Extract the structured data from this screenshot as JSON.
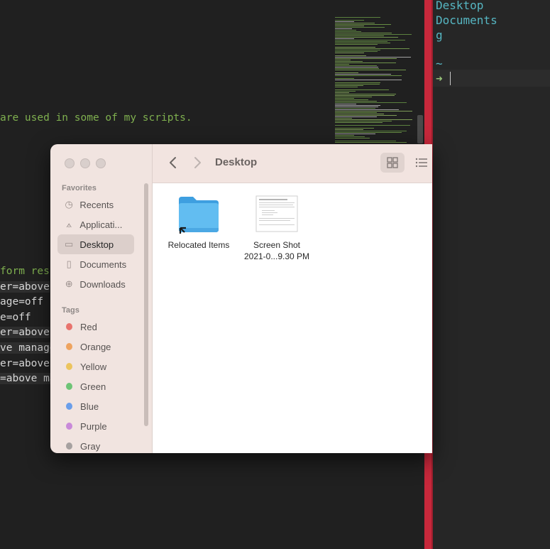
{
  "editor": {
    "lines": [
      {
        "text": "are used in some of my scripts.",
        "kind": "comment"
      },
      {
        "text": "form resi",
        "kind": "comment"
      },
      {
        "text": "er=above",
        "kind": "hl"
      },
      {
        "text": "age=off",
        "kind": "plain"
      },
      {
        "text": "e=off",
        "kind": "plain"
      },
      {
        "text": "er=above",
        "kind": "hl"
      },
      {
        "text": "ve manage",
        "kind": "hl"
      },
      {
        "text": "er=above",
        "kind": "plain"
      },
      {
        "text": "=above ma",
        "kind": "hl"
      }
    ]
  },
  "terminal": {
    "lines": [
      "Desktop",
      "Documents",
      "g"
    ],
    "tilde": "~",
    "prompt_symbol": "➜"
  },
  "finder": {
    "title": "Desktop",
    "favorites_header": "Favorites",
    "favorites": [
      {
        "label": "Recents",
        "icon": "clock-icon"
      },
      {
        "label": "Applicati...",
        "icon": "applications-icon"
      },
      {
        "label": "Desktop",
        "icon": "desktop-icon",
        "active": true
      },
      {
        "label": "Documents",
        "icon": "document-icon"
      },
      {
        "label": "Downloads",
        "icon": "download-icon"
      }
    ],
    "tags_header": "Tags",
    "tags": [
      {
        "label": "Red",
        "color": "#e8736d"
      },
      {
        "label": "Orange",
        "color": "#eea35f"
      },
      {
        "label": "Yellow",
        "color": "#ecc45e"
      },
      {
        "label": "Green",
        "color": "#6ec476"
      },
      {
        "label": "Blue",
        "color": "#6a9eea"
      },
      {
        "label": "Purple",
        "color": "#c98ad9"
      },
      {
        "label": "Gray",
        "color": "#a6a1a0"
      }
    ],
    "files": [
      {
        "name": "Relocated Items",
        "type": "folder-alias"
      },
      {
        "name": "Screen Shot",
        "name_line2": "2021-0...9.30 PM",
        "type": "image"
      }
    ]
  },
  "colors": {
    "accent_divider": "#c7283b",
    "terminal_text": "#56b6c2",
    "prompt": "#98c379",
    "folder": "#5cb4ec"
  }
}
